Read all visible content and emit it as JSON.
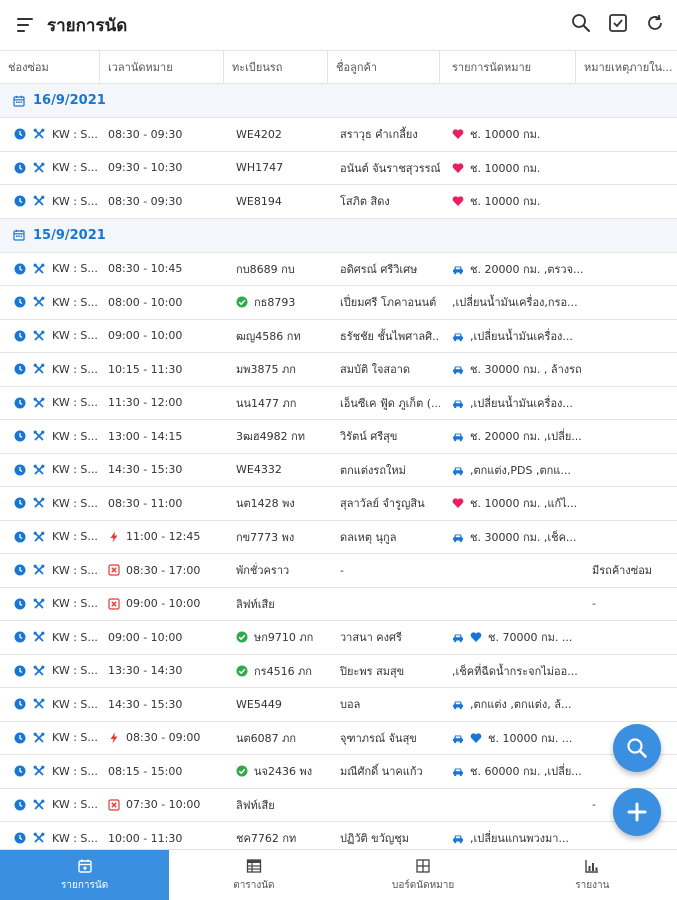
{
  "app": {
    "title": "รายการนัด"
  },
  "columns": [
    "ช่องซ่อม",
    "เวลานัดหมาย",
    "ทะเบียนรถ",
    "ชื่อลูกค้า",
    "รายการนัดหมาย",
    "หมายเหตุภายใน..."
  ],
  "groups": [
    {
      "date": "16/9/2021",
      "rows": [
        {
          "bay": "KW : S...",
          "time_icon": "",
          "time": "08:30 - 09:30",
          "plate_icon": "",
          "plate": "WE4202",
          "customer": "สราวุธ คำเกลี้ยง",
          "items_icons": [
            "heart"
          ],
          "items": "ช. 10000 กม.",
          "note": ""
        },
        {
          "bay": "KW : S...",
          "time_icon": "",
          "time": "09:30 - 10:30",
          "plate_icon": "",
          "plate": "WH1747",
          "customer": "อนันต์ จันราชสุวรรณ์",
          "items_icons": [
            "heart"
          ],
          "items": "ช. 10000 กม.",
          "note": ""
        },
        {
          "bay": "KW : S...",
          "time_icon": "",
          "time": "08:30 - 09:30",
          "plate_icon": "",
          "plate": "WE8194",
          "customer": "โสภิต สิดง",
          "items_icons": [
            "heart"
          ],
          "items": "ช. 10000 กม.",
          "note": ""
        }
      ]
    },
    {
      "date": "15/9/2021",
      "rows": [
        {
          "bay": "KW : S...",
          "time_icon": "",
          "time": "08:30 - 10:45",
          "plate_icon": "",
          "plate": "กบ8689 กบ",
          "customer": "อดิศรณ์ ศรีวิเศษ",
          "items_icons": [
            "car"
          ],
          "items": "ช. 20000 กม. ,ตรวจ...",
          "note": ""
        },
        {
          "bay": "KW : S...",
          "time_icon": "",
          "time": "08:00 - 10:00",
          "plate_icon": "check",
          "plate": "กธ8793",
          "customer": "เปี่ยมศรี โภคาอนนต์",
          "items_icons": [],
          "items": ",เปลี่ยนน้ำมันเครื่อง,กรอ...",
          "note": ""
        },
        {
          "bay": "KW : S...",
          "time_icon": "",
          "time": "09:00 - 10:00",
          "plate_icon": "",
          "plate": "ฒญ4586 กท",
          "customer": "ธรัชชัย ชั้นไพศาลศิ...",
          "items_icons": [
            "car"
          ],
          "items": ",เปลี่ยนน้ำมันเครื่อง...",
          "note": ""
        },
        {
          "bay": "KW : S...",
          "time_icon": "",
          "time": "10:15 - 11:30",
          "plate_icon": "",
          "plate": "มพ3875 ภก",
          "customer": "สมบัติ ใจสอาด",
          "items_icons": [
            "car"
          ],
          "items": "ช. 30000 กม. , ล้างรถ",
          "note": ""
        },
        {
          "bay": "KW : S...",
          "time_icon": "",
          "time": "11:30 - 12:00",
          "plate_icon": "",
          "plate": "นน1477 ภก",
          "customer": "เอ็นซีเค ฟู้ด ภูเก็ต (...",
          "items_icons": [
            "car"
          ],
          "items": ",เปลี่ยนน้ำมันเครื่อง...",
          "note": ""
        },
        {
          "bay": "KW : S...",
          "time_icon": "",
          "time": "13:00 - 14:15",
          "plate_icon": "",
          "plate": "3ฒฮ4982 กท",
          "customer": "วิรัตน์ ศรีสุข",
          "items_icons": [
            "car"
          ],
          "items": "ช. 20000 กม. ,เปลี่ย...",
          "note": ""
        },
        {
          "bay": "KW : S...",
          "time_icon": "",
          "time": "14:30 - 15:30",
          "plate_icon": "",
          "plate": "WE4332",
          "customer": "ตกแต่งรถใหม่",
          "items_icons": [
            "car"
          ],
          "items": ",ตกแต่ง,PDS ,ตกแ...",
          "note": ""
        },
        {
          "bay": "KW : S...",
          "time_icon": "",
          "time": "08:30 - 11:00",
          "plate_icon": "",
          "plate": "นต1428 พง",
          "customer": "สุลาวัลย์ จำรูญสิน",
          "items_icons": [
            "heart"
          ],
          "items": "ช. 10000 กม. ,แก้ไ...",
          "note": ""
        },
        {
          "bay": "KW : S...",
          "time_icon": "bolt",
          "time": "11:00 - 12:45",
          "plate_icon": "",
          "plate": "กข7773 พง",
          "customer": "ดลเหตุ นุกูล",
          "items_icons": [
            "car"
          ],
          "items": "ช. 30000 กม. ,เช็ค...",
          "note": ""
        },
        {
          "bay": "KW : S...",
          "time_icon": "cross",
          "time": "08:30 - 17:00",
          "plate_icon": "",
          "plate": "พักชั่วคราว",
          "customer": "-",
          "items_icons": [],
          "items": "",
          "note": "มีรถค้างซ่อม"
        },
        {
          "bay": "KW : S...",
          "time_icon": "cross",
          "time": "09:00 - 10:00",
          "plate_icon": "",
          "plate": "ลิฟท์เสีย",
          "customer": "",
          "items_icons": [],
          "items": "",
          "note": "-"
        },
        {
          "bay": "KW : S...",
          "time_icon": "",
          "time": "09:00 - 10:00",
          "plate_icon": "check",
          "plate": "ษก9710 ภก",
          "customer": "วาสนา คงศรี",
          "items_icons": [
            "car",
            "heart-blue"
          ],
          "items": "ช. 70000 กม. ...",
          "note": ""
        },
        {
          "bay": "KW : S...",
          "time_icon": "",
          "time": "13:30 - 14:30",
          "plate_icon": "check",
          "plate": "กร4516 ภก",
          "customer": "ปิยะพร สมสุข",
          "items_icons": [],
          "items": ",เช็คที่ฉีดน้ำกระจกไม่ออ...",
          "note": ""
        },
        {
          "bay": "KW : S...",
          "time_icon": "",
          "time": "14:30 - 15:30",
          "plate_icon": "",
          "plate": "WE5449",
          "customer": "บอล",
          "items_icons": [
            "car"
          ],
          "items": ",ตกแต่ง ,ตกแต่ง, ล้...",
          "note": ""
        },
        {
          "bay": "KW : S...",
          "time_icon": "bolt",
          "time": "08:30 - 09:00",
          "plate_icon": "",
          "plate": "นต6087 ภก",
          "customer": "จุฑาภรณ์ จันสุข",
          "items_icons": [
            "car",
            "heart-blue"
          ],
          "items": "ช. 10000 กม. ...",
          "note": ""
        },
        {
          "bay": "KW : S...",
          "time_icon": "",
          "time": "08:15 - 15:00",
          "plate_icon": "check",
          "plate": "นจ2436 พง",
          "customer": "มณีศักดิ์ นาคแก้ว",
          "items_icons": [
            "car"
          ],
          "items": "ช. 60000 กม. ,เปลี่ย...",
          "note": ""
        },
        {
          "bay": "KW : S...",
          "time_icon": "cross",
          "time": "07:30 - 10:00",
          "plate_icon": "",
          "plate": "ลิฟท์เสีย",
          "customer": "",
          "items_icons": [],
          "items": "",
          "note": "-"
        },
        {
          "bay": "KW : S...",
          "time_icon": "",
          "time": "10:00 - 11:30",
          "plate_icon": "",
          "plate": "ชค7762 กท",
          "customer": "ปฏิวัติ ขวัญชุม",
          "items_icons": [
            "car"
          ],
          "items": ",เปลี่ยนแกนพวงมา...",
          "note": ""
        }
      ]
    }
  ],
  "nav": [
    {
      "label": "รายการนัด",
      "icon": "calendar-icon",
      "active": true
    },
    {
      "label": "ตารางนัด",
      "icon": "schedule-icon",
      "active": false
    },
    {
      "label": "บอร์ดนัดหมาย",
      "icon": "board-icon",
      "active": false
    },
    {
      "label": "รายงาน",
      "icon": "report-icon",
      "active": false
    }
  ],
  "colors": {
    "primary": "#3b8fe0",
    "date": "#1976d2",
    "heart": "#e91e63",
    "check": "#2eaa4a",
    "bolt": "#e53935"
  },
  "icons": {
    "top_actions": [
      "search-icon",
      "checkbox-icon",
      "refresh-icon"
    ],
    "fabs": [
      "search-icon",
      "add-icon"
    ]
  }
}
